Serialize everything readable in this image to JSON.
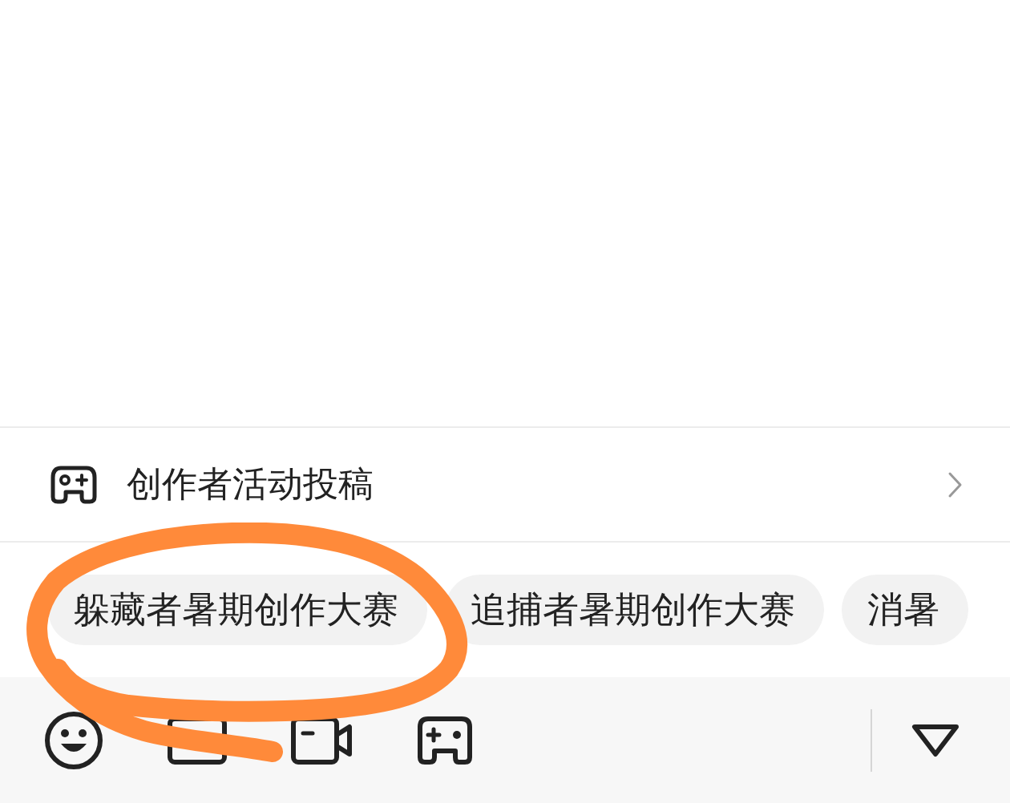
{
  "activity_row": {
    "label": "创作者活动投稿"
  },
  "chips": [
    {
      "label": "躲藏者暑期创作大赛"
    },
    {
      "label": "追捕者暑期创作大赛"
    },
    {
      "label": "消暑"
    }
  ]
}
